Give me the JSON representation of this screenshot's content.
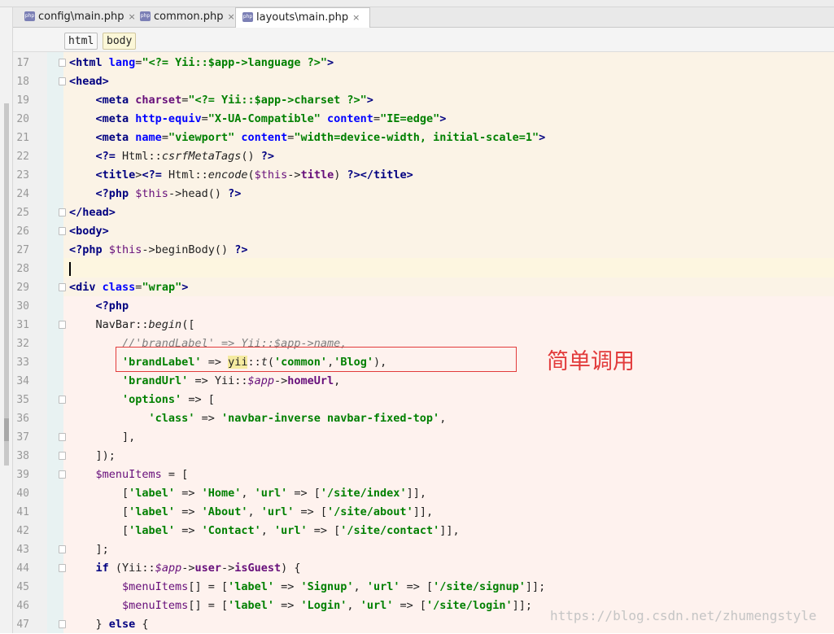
{
  "tabs": [
    {
      "label": "config\\main.php",
      "close": "×",
      "active": false
    },
    {
      "label": "common.php",
      "close": "×",
      "active": false
    },
    {
      "label": "layouts\\main.php",
      "close": "×",
      "active": true
    }
  ],
  "file_icon_text": "php",
  "breadcrumb": [
    "html",
    "body"
  ],
  "annotation": "简单调用",
  "watermark": "https://blog.csdn.net/zhumengstyle",
  "lines": [
    {
      "n": "17",
      "code": "<html lang=\"<?= Yii::$app->language ?>\">"
    },
    {
      "n": "18",
      "code": "<head>"
    },
    {
      "n": "19",
      "code": "    <meta charset=\"<?= Yii::$app->charset ?>\">"
    },
    {
      "n": "20",
      "code": "    <meta http-equiv=\"X-UA-Compatible\" content=\"IE=edge\">"
    },
    {
      "n": "21",
      "code": "    <meta name=\"viewport\" content=\"width=device-width, initial-scale=1\">"
    },
    {
      "n": "22",
      "code": "    <?= Html::csrfMetaTags() ?>"
    },
    {
      "n": "23",
      "code": "    <title><?= Html::encode($this->title) ?></title>"
    },
    {
      "n": "24",
      "code": "    <?php $this->head() ?>"
    },
    {
      "n": "25",
      "code": "</head>"
    },
    {
      "n": "26",
      "code": "<body>"
    },
    {
      "n": "27",
      "code": "<?php $this->beginBody() ?>"
    },
    {
      "n": "28",
      "code": ""
    },
    {
      "n": "29",
      "code": "<div class=\"wrap\">"
    },
    {
      "n": "30",
      "code": "    <?php"
    },
    {
      "n": "31",
      "code": "    NavBar::begin(["
    },
    {
      "n": "32",
      "code": "        //'brandLabel' => Yii::$app->name,"
    },
    {
      "n": "33",
      "code": "        'brandLabel' => yii::t('common','Blog'),"
    },
    {
      "n": "34",
      "code": "        'brandUrl' => Yii::$app->homeUrl,"
    },
    {
      "n": "35",
      "code": "        'options' => ["
    },
    {
      "n": "36",
      "code": "            'class' => 'navbar-inverse navbar-fixed-top',"
    },
    {
      "n": "37",
      "code": "        ],"
    },
    {
      "n": "38",
      "code": "    ]);"
    },
    {
      "n": "39",
      "code": "    $menuItems = ["
    },
    {
      "n": "40",
      "code": "        ['label' => 'Home', 'url' => ['/site/index']],"
    },
    {
      "n": "41",
      "code": "        ['label' => 'About', 'url' => ['/site/about']],"
    },
    {
      "n": "42",
      "code": "        ['label' => 'Contact', 'url' => ['/site/contact']],"
    },
    {
      "n": "43",
      "code": "    ];"
    },
    {
      "n": "44",
      "code": "    if (Yii::$app->user->isGuest) {"
    },
    {
      "n": "45",
      "code": "        $menuItems[] = ['label' => 'Signup', 'url' => ['/site/signup']];"
    },
    {
      "n": "46",
      "code": "        $menuItems[] = ['label' => 'Login', 'url' => ['/site/login']];"
    },
    {
      "n": "47",
      "code": "    } else {"
    }
  ],
  "colors": {
    "html_region_bg": "#fbf3e6",
    "current_line_bg": "#fdf6e0",
    "php_region_bg": "#fef2ee",
    "annotation": "#e23b3b",
    "tag": "#000080",
    "attr": "#0000ff",
    "string": "#008000",
    "variable": "#660e7a",
    "comment": "#808080"
  }
}
